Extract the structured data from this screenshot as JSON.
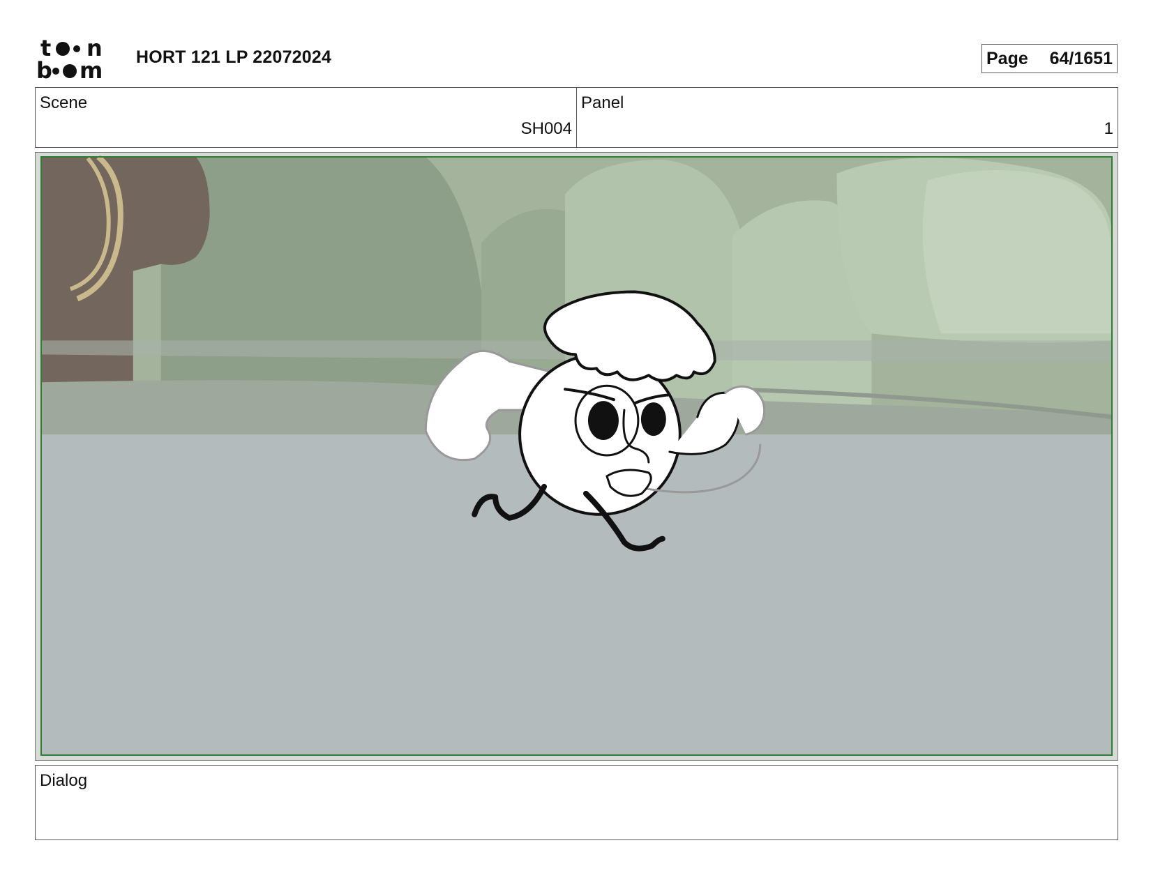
{
  "header": {
    "logo_icon": "toon-boom-logo",
    "project_title": "HORT 121 LP 22072024",
    "page_label": "Page",
    "page_number": "64/1651"
  },
  "scene": {
    "label": "Scene",
    "value": "SH004"
  },
  "panel": {
    "label": "Panel",
    "value": "1"
  },
  "frame": {
    "safe_area_color": "#2e7d32",
    "sky_color": "#a3b39c",
    "ground_color": "#b4bbbd",
    "subject": "running-character-sketch"
  },
  "dialog": {
    "label": "Dialog",
    "text": ""
  }
}
